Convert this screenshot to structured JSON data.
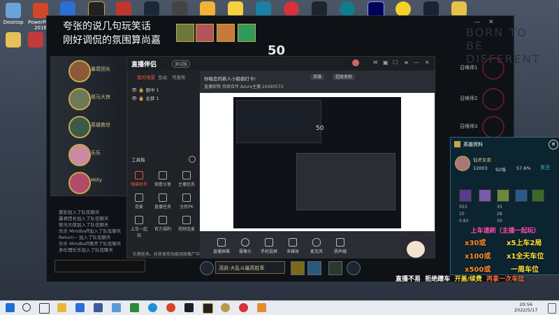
{
  "desktop": {
    "icons": [
      {
        "label": "Desktop"
      },
      {
        "label": "PowerPoint 2016"
      },
      {
        "label": ""
      },
      {
        "label": ""
      }
    ]
  },
  "overlay": {
    "line1": "夸张的说几句玩笑话",
    "line2": "刚好调侃的氛围算尚嘉"
  },
  "game": {
    "score": "50",
    "watermark": "BORN TO BE DIFFERENT",
    "left_players": [
      {
        "name": "暴君团长"
      },
      {
        "name": "斑马大侠"
      },
      {
        "name": "英雄救世"
      },
      {
        "name": "乐乐"
      },
      {
        "name": "Milly"
      }
    ],
    "right_slots": [
      {
        "name": "召唤师1"
      },
      {
        "name": "召唤师2"
      },
      {
        "name": "召唤师3"
      }
    ],
    "chat_lines": [
      "莫钞加入了队伍聊天",
      "暴君团长加入了队伍聊天",
      "斑马大侠加入了队伍聊天",
      "乐乐 Mmdbaff加入了队伍聊天",
      "Return~ 加入了队伍聊天",
      "乐乐 Mmdbaff离开了队伍聊天",
      "多伦理乐乐加入了队伍聊天"
    ],
    "rank_select": "茂凯-大乱斗最高胜率"
  },
  "app": {
    "name": "直播伴侣",
    "beta": "测试版",
    "side_tabs": [
      "我的场景",
      "互动",
      "可发布"
    ],
    "scenes": [
      "画中 1",
      "全屏 1"
    ],
    "tools_label": "工具箱",
    "tools": [
      {
        "label": "弹幕助手",
        "red": true
      },
      {
        "label": "观看分享"
      },
      {
        "label": "主播任务"
      },
      {
        "label": "连麦"
      },
      {
        "label": "直播任务"
      },
      {
        "label": "全民PK"
      },
      {
        "label": "上车一起玩"
      },
      {
        "label": "官方福利"
      },
      {
        "label": "视频连麦"
      }
    ],
    "notice": "礼物任务、抖音发布功能持续推广中、敬请期待",
    "stream_title": "你暗恋的新人小姐姐打卡!",
    "chips": [
      "英雄",
      "超级发射"
    ],
    "sub_info": {
      "tag1": "直播权限",
      "tag2": "持续合作",
      "uid": "Azure主播  10493573"
    },
    "bottom_tools": [
      "直播屏幕",
      "摄像头",
      "手机投屏",
      "多媒体",
      "麦克风",
      "扬声器"
    ]
  },
  "hero_panel": {
    "title": "英雄资料",
    "hero_name": "仙灵女巫",
    "games": "12003",
    "score": "92场",
    "winrate": "57.6%",
    "follow": "关注",
    "item_nums": [
      "553",
      "35",
      "10",
      "28",
      "0.83",
      "30"
    ],
    "recruit": "上车请刷（主播一起玩）",
    "promos": [
      {
        "text": "x30或",
        "right": "x5上车2局"
      },
      {
        "text": "x100或",
        "right": "x1全天车位"
      },
      {
        "text": "x500或",
        "right": "一周车位"
      }
    ]
  },
  "banner": {
    "left": "直播不易",
    "mid": "拒绝蹭车",
    "right": "开盖/续费",
    "end": "再拿一次车位"
  },
  "taskbar": {
    "time": "20:56",
    "date": "2022/5/17"
  }
}
